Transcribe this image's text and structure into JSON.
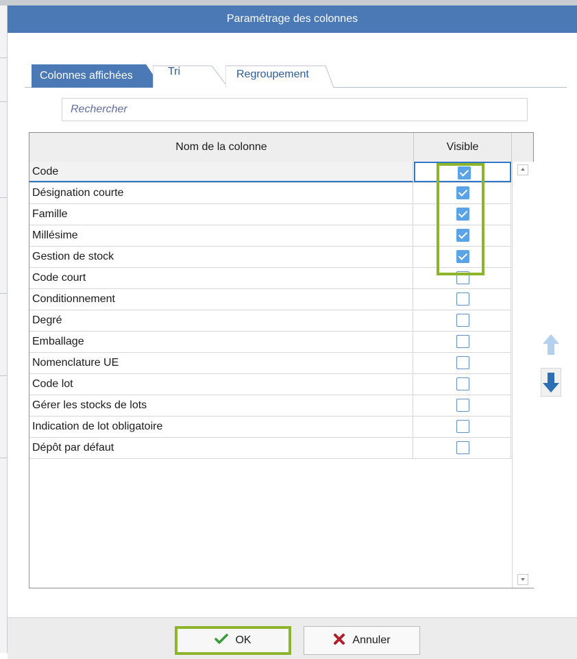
{
  "dialog": {
    "title": "Paramétrage des colonnes"
  },
  "tabs": [
    {
      "label": "Colonnes affichées",
      "active": true
    },
    {
      "label": "Tri",
      "active": false
    },
    {
      "label": "Regroupement",
      "active": false
    }
  ],
  "search": {
    "placeholder": "Rechercher",
    "value": ""
  },
  "grid": {
    "headers": {
      "name": "Nom de la colonne",
      "visible": "Visible"
    },
    "rows": [
      {
        "label": "Code",
        "visible": true
      },
      {
        "label": "Désignation courte",
        "visible": true
      },
      {
        "label": "Famille",
        "visible": true
      },
      {
        "label": "Millésime",
        "visible": true
      },
      {
        "label": "Gestion de stock",
        "visible": true
      },
      {
        "label": "Code court",
        "visible": false
      },
      {
        "label": "Conditionnement",
        "visible": false
      },
      {
        "label": "Degré",
        "visible": false
      },
      {
        "label": "Emballage",
        "visible": false
      },
      {
        "label": "Nomenclature UE",
        "visible": false
      },
      {
        "label": "Code lot",
        "visible": false
      },
      {
        "label": "Gérer les stocks de lots",
        "visible": false
      },
      {
        "label": "Indication de lot obligatoire",
        "visible": false
      },
      {
        "label": "Dépôt par défaut",
        "visible": false
      }
    ]
  },
  "footer": {
    "ok_label": "OK",
    "cancel_label": "Annuler"
  },
  "colors": {
    "accent": "#4a79b5",
    "highlight": "#8db52c",
    "checkbox_on": "#5aa3e6",
    "cancel_icon": "#b01e2a",
    "ok_icon": "#3a9a3a"
  },
  "icons": {
    "ok": "check-icon",
    "cancel": "x-icon",
    "move_up": "arrow-up-icon",
    "move_down": "arrow-down-icon"
  }
}
